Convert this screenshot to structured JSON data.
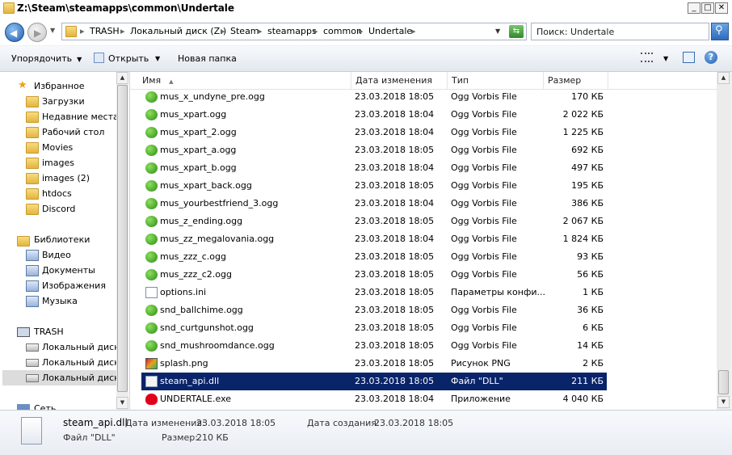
{
  "window": {
    "title": "Z:\\Steam\\steamapps\\common\\Undertale"
  },
  "address": {
    "crumbs": [
      "TRASH",
      "Локальный диск (Z:)",
      "Steam",
      "steamapps",
      "common",
      "Undertale"
    ]
  },
  "search": {
    "placeholder": "Поиск: Undertale"
  },
  "toolbar": {
    "organize": "Упорядочить",
    "open": "Открыть",
    "new_folder": "Новая папка"
  },
  "nav": {
    "favorites_label": "Избранное",
    "favorites": [
      "Загрузки",
      "Недавние места",
      "Рабочий стол",
      "Movies",
      "images",
      "images (2)",
      "htdocs",
      "Discord"
    ],
    "libraries_label": "Библиотеки",
    "libraries": [
      "Видео",
      "Документы",
      "Изображения",
      "Музыка"
    ],
    "computer_label": "TRASH",
    "drives": [
      "Локальный диск (",
      "Локальный диск (",
      "Локальный диск ("
    ],
    "network_label": "Сеть"
  },
  "columns": {
    "name": "Имя",
    "date": "Дата изменения",
    "type": "Тип",
    "size": "Размер"
  },
  "files": [
    {
      "name": "mus_x_undyne_pre.ogg",
      "date": "23.03.2018 18:05",
      "type": "Ogg Vorbis File",
      "size": "170 КБ",
      "icon": "ogg"
    },
    {
      "name": "mus_xpart.ogg",
      "date": "23.03.2018 18:04",
      "type": "Ogg Vorbis File",
      "size": "2 022 КБ",
      "icon": "ogg"
    },
    {
      "name": "mus_xpart_2.ogg",
      "date": "23.03.2018 18:04",
      "type": "Ogg Vorbis File",
      "size": "1 225 КБ",
      "icon": "ogg"
    },
    {
      "name": "mus_xpart_a.ogg",
      "date": "23.03.2018 18:05",
      "type": "Ogg Vorbis File",
      "size": "692 КБ",
      "icon": "ogg"
    },
    {
      "name": "mus_xpart_b.ogg",
      "date": "23.03.2018 18:04",
      "type": "Ogg Vorbis File",
      "size": "497 КБ",
      "icon": "ogg"
    },
    {
      "name": "mus_xpart_back.ogg",
      "date": "23.03.2018 18:05",
      "type": "Ogg Vorbis File",
      "size": "195 КБ",
      "icon": "ogg"
    },
    {
      "name": "mus_yourbestfriend_3.ogg",
      "date": "23.03.2018 18:04",
      "type": "Ogg Vorbis File",
      "size": "386 КБ",
      "icon": "ogg"
    },
    {
      "name": "mus_z_ending.ogg",
      "date": "23.03.2018 18:05",
      "type": "Ogg Vorbis File",
      "size": "2 067 КБ",
      "icon": "ogg"
    },
    {
      "name": "mus_zz_megalovania.ogg",
      "date": "23.03.2018 18:04",
      "type": "Ogg Vorbis File",
      "size": "1 824 КБ",
      "icon": "ogg"
    },
    {
      "name": "mus_zzz_c.ogg",
      "date": "23.03.2018 18:05",
      "type": "Ogg Vorbis File",
      "size": "93 КБ",
      "icon": "ogg"
    },
    {
      "name": "mus_zzz_c2.ogg",
      "date": "23.03.2018 18:05",
      "type": "Ogg Vorbis File",
      "size": "56 КБ",
      "icon": "ogg"
    },
    {
      "name": "options.ini",
      "date": "23.03.2018 18:05",
      "type": "Параметры конфи...",
      "size": "1 КБ",
      "icon": "ini"
    },
    {
      "name": "snd_ballchime.ogg",
      "date": "23.03.2018 18:05",
      "type": "Ogg Vorbis File",
      "size": "36 КБ",
      "icon": "ogg"
    },
    {
      "name": "snd_curtgunshot.ogg",
      "date": "23.03.2018 18:05",
      "type": "Ogg Vorbis File",
      "size": "6 КБ",
      "icon": "ogg"
    },
    {
      "name": "snd_mushroomdance.ogg",
      "date": "23.03.2018 18:05",
      "type": "Ogg Vorbis File",
      "size": "14 КБ",
      "icon": "ogg"
    },
    {
      "name": "splash.png",
      "date": "23.03.2018 18:05",
      "type": "Рисунок PNG",
      "size": "2 КБ",
      "icon": "png"
    },
    {
      "name": "steam_api.dll",
      "date": "23.03.2018 18:05",
      "type": "Файл \"DLL\"",
      "size": "211 КБ",
      "icon": "dll",
      "selected": true
    },
    {
      "name": "UNDERTALE.exe",
      "date": "23.03.2018 18:04",
      "type": "Приложение",
      "size": "4 040 КБ",
      "icon": "exe"
    }
  ],
  "details": {
    "filename": "steam_api.dll",
    "filetype": "Файл \"DLL\"",
    "modified_label": "Дата изменения:",
    "modified_value": "23.03.2018 18:05",
    "created_label": "Дата создания:",
    "created_value": "23.03.2018 18:05",
    "size_label": "Размер:",
    "size_value": "210 КБ"
  },
  "colors": {
    "selection": "#0a246a",
    "accent": "#1f5fb4"
  }
}
